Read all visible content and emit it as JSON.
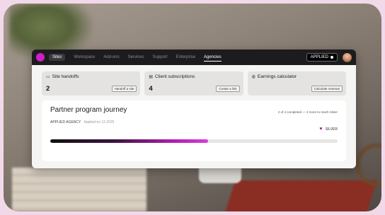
{
  "nav": {
    "items": [
      {
        "label": "Sites",
        "active": true
      },
      {
        "label": "Workspace"
      },
      {
        "label": "Add-ons"
      },
      {
        "label": "Services"
      },
      {
        "label": "Support"
      },
      {
        "label": "Enterprise"
      },
      {
        "label": "Agencies",
        "underlined": true
      }
    ],
    "applied_label": "APPLIED"
  },
  "cards": [
    {
      "title": "Site handoffs",
      "icon": "window-icon",
      "value": "2",
      "button": "Handoff a site"
    },
    {
      "title": "Client subscriptions",
      "icon": "calendar-icon",
      "value": "4",
      "button": "Create a link"
    },
    {
      "title": "Earnings calculator",
      "icon": "coins-icon",
      "value": "",
      "button": "Calculate revenue"
    }
  ],
  "journey": {
    "title": "Partner program journey",
    "progress_text": "2 of 4 completed — 2 more to reach Silver",
    "level": "APPLIED AGENCY",
    "applied_date": "Applied on 12.2025",
    "badge": "SILVER",
    "progress_fraction": 0.55
  },
  "colors": {
    "accent": "#d01fc5",
    "badge_heart": "#a1138f"
  }
}
